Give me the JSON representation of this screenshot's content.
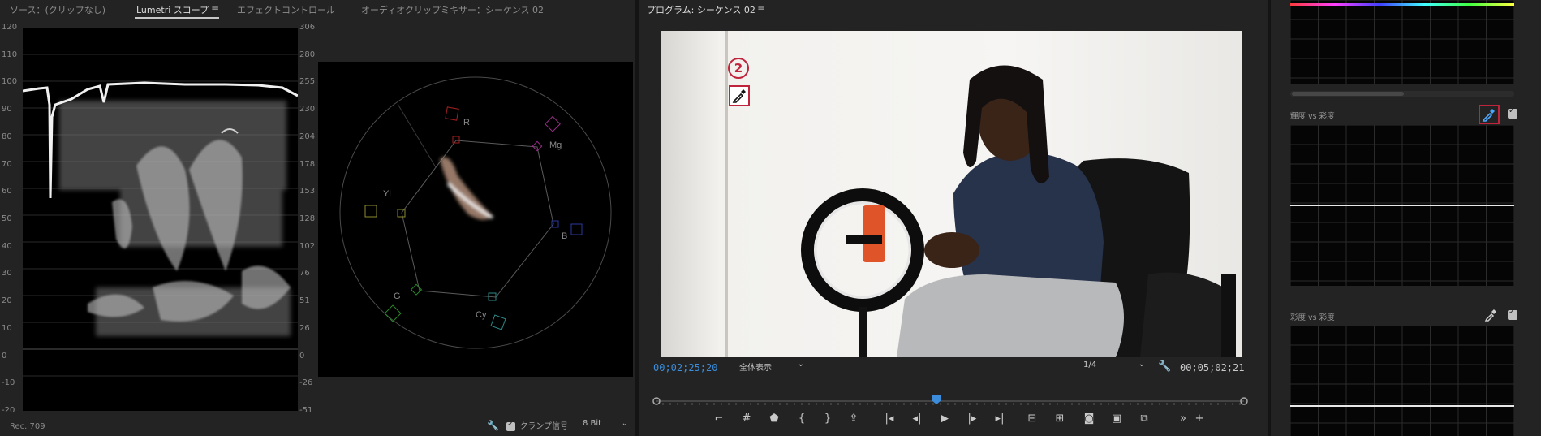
{
  "tabs": [
    {
      "label": "ソース：(クリップなし)"
    },
    {
      "label": "Lumetri スコープ"
    },
    {
      "label": "エフェクトコントロール"
    },
    {
      "label": "オーディオクリップミキサー：シーケンス 02"
    }
  ],
  "menu_glyph": "≡",
  "waveform": {
    "left_axis": [
      "120",
      "110",
      "100",
      "90",
      "80",
      "70",
      "60",
      "50",
      "40",
      "30",
      "20",
      "10",
      "0",
      "-10",
      "-20"
    ],
    "right_axis": [
      "306",
      "280",
      "255",
      "230",
      "204",
      "178",
      "153",
      "128",
      "102",
      "76",
      "51",
      "26",
      "0",
      "-26",
      "-51"
    ],
    "footer_label": "Rec. 709"
  },
  "vectorscope": {
    "labels": {
      "r": "R",
      "mg": "Mg",
      "yl": "Yl",
      "b": "B",
      "g": "G",
      "cy": "Cy"
    }
  },
  "scope_tools": {
    "clamp_label": "クランプ信号",
    "bit_depth": "8 Bit"
  },
  "program": {
    "title": "プログラム: シーケンス 02",
    "timecode_current": "00;02;25;20",
    "zoom": "全体表示",
    "resolution": "1/4",
    "timecode_duration": "00;05;02;21",
    "annotation_number": "2"
  },
  "curves": {
    "luma_vs_sat_label": "輝度 vs 彩度",
    "sat_vs_sat_label": "彩度 vs 彩度"
  },
  "colors": {
    "accent_blue": "#3b8ddb",
    "annotation_red": "#c0243c"
  }
}
